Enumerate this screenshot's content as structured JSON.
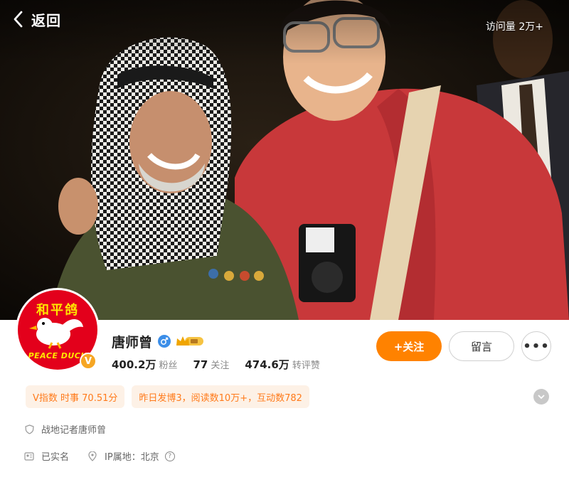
{
  "header": {
    "back_label": "返回",
    "visits": "访问量 2万+"
  },
  "avatar": {
    "top_text": "和平鸽",
    "bottom_text": "PEACE DUCK",
    "badge": "V"
  },
  "profile": {
    "name": "唐师曾",
    "gender_icon": "male-icon",
    "vip_icon": "crown-vip-icon",
    "stats": {
      "fans_num": "400.2万",
      "fans_label": "粉丝",
      "follow_num": "77",
      "follow_label": "关注",
      "interact_num": "474.6万",
      "interact_label": "转评赞"
    }
  },
  "actions": {
    "follow_label": "+关注",
    "message_label": "留言",
    "more_label": "•••"
  },
  "tags": {
    "v_index": "V指数 时事 70.51分",
    "yesterday": "昨日发博3，阅读数10万+，互动数782"
  },
  "info": {
    "bio": "战地记者唐师曾",
    "verified": "已实名",
    "ip_label": "IP属地：北京"
  },
  "colors": {
    "accent": "#ff8200",
    "tag_bg": "#fdf1e6",
    "tag_text": "#ff7a1a",
    "avatar_red": "#e3001b"
  }
}
